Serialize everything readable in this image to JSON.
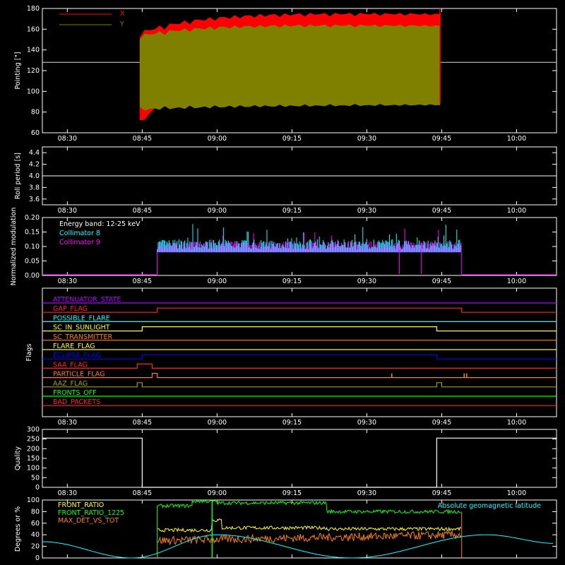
{
  "time_ticks": [
    "08:30",
    "08:45",
    "09:00",
    "09:15",
    "09:30",
    "09:45",
    "10:00"
  ],
  "colors": {
    "x": "#ff0000",
    "y": "#808000",
    "white": "#ffffff",
    "cyan": "#00ffff",
    "magenta": "#ff00ff",
    "yellow": "#ffff00",
    "orange": "#ff8000",
    "green": "#00ff00",
    "blue": "#0000ff",
    "purple": "#b000ff",
    "olive": "#a0a000",
    "red": "#ff2020"
  },
  "chart_data": [
    {
      "type": "area",
      "id": "pointing",
      "ylabel": "Pointing [\"]",
      "ylim": [
        60,
        180
      ],
      "yticks": [
        "60",
        "80",
        "100",
        "120",
        "140",
        "160",
        "180"
      ],
      "legend": [
        "X",
        "Y"
      ],
      "x_range": [
        "08:25",
        "10:08"
      ],
      "reference_value": 128,
      "data_span": [
        "08:44:30",
        "09:44:40"
      ],
      "series": [
        {
          "name": "X",
          "lower_start": 72,
          "lower_end": 136,
          "upper_start": 152,
          "upper_end": 173
        },
        {
          "name": "Y",
          "lower_start": 85,
          "lower_end": 88,
          "upper_start": 150,
          "upper_end": 162
        }
      ]
    },
    {
      "type": "line",
      "id": "roll_period",
      "ylabel": "Roll period [s]",
      "ylim": [
        3.5,
        4.5
      ],
      "yticks": [
        "3.6",
        "3.8",
        "4.0",
        "4.2",
        "4.4"
      ],
      "series": [
        {
          "name": "",
          "value": 4.0
        }
      ]
    },
    {
      "type": "bar",
      "id": "modulation",
      "ylabel": "Normalized modulation",
      "ylim": [
        0,
        0.2
      ],
      "yticks": [
        "0.00",
        "0.05",
        "0.10",
        "0.15",
        "0.20"
      ],
      "annotation": "Energy band: 12-25 keV",
      "legend": [
        "Collimator 8",
        "Collimator 9"
      ],
      "data_span": [
        "08:48",
        "09:49"
      ],
      "baseline": 0.09,
      "peak": 0.19
    },
    {
      "type": "line",
      "id": "flags",
      "ylabel": "Flags",
      "flags": [
        {
          "name": "ATTENUATOR_STATE",
          "color": "#b000ff",
          "steps": []
        },
        {
          "name": "GAP_FLAG",
          "color": "#ff2020",
          "steps": [
            [
              "08:48",
              "09:49"
            ]
          ]
        },
        {
          "name": "POSSIBLE_FLARE",
          "color": "#00ffff",
          "steps": []
        },
        {
          "name": "SC_IN_SUNLIGHT",
          "color": "#ffff00",
          "steps": [
            [
              "08:45",
              "09:44"
            ]
          ]
        },
        {
          "name": "SC_TRANSMITTER",
          "color": "#ff8000",
          "steps": []
        },
        {
          "name": "FLARE_FLAG",
          "color": "#ffff00",
          "steps": []
        },
        {
          "name": "ECLIPSE_FLAG",
          "color": "#0000ff",
          "steps": [
            [
              "08:45",
              "09:44"
            ]
          ]
        },
        {
          "name": "SAA_FLAG",
          "color": "#ff2020",
          "steps": [
            [
              "08:44",
              "08:47"
            ]
          ]
        },
        {
          "name": "PARTICLE_FLAG",
          "color": "#ff8000",
          "steps": [
            [
              "08:47",
              "08:48"
            ]
          ]
        },
        {
          "name": "AAZ_FLAG",
          "color": "#a0a000",
          "steps": [
            [
              "08:44",
              "08:45"
            ],
            [
              "09:44",
              "09:45"
            ]
          ]
        },
        {
          "name": "FRONTS_OFF",
          "color": "#00ff00",
          "steps": []
        },
        {
          "name": "BAD_PACKETS",
          "color": "#ff2020",
          "steps": []
        }
      ]
    },
    {
      "type": "line",
      "id": "quality",
      "ylabel": "Quality",
      "ylim": [
        0,
        300
      ],
      "yticks": [
        "0",
        "50",
        "100",
        "150",
        "200",
        "250",
        "300"
      ],
      "series": [
        {
          "name": "",
          "value_outside": 255,
          "value_inside": 0,
          "span": [
            "08:45",
            "09:44"
          ]
        }
      ]
    },
    {
      "type": "line",
      "id": "ratios",
      "ylabel": "Degrees or %",
      "ylim": [
        0,
        100
      ],
      "yticks": [
        "0",
        "20",
        "40",
        "60",
        "80",
        "100"
      ],
      "legend": [
        "FRONT_RATIO",
        "FRONT_RATIO_1225",
        "MAX_DET_VS_TOT"
      ],
      "annotation": "Absolute geomagnetic latitude",
      "series": [
        {
          "name": "FRONT_RATIO",
          "levels": [
            [
              "08:48",
              "08:59",
              48
            ],
            [
              "08:59",
              "09:01",
              65
            ],
            [
              "09:01",
              "09:22",
              52
            ],
            [
              "09:22",
              "09:49",
              50
            ]
          ]
        },
        {
          "name": "FRONT_RATIO_1225",
          "levels": [
            [
              "08:48",
              "08:55",
              90
            ],
            [
              "08:55",
              "09:00",
              98
            ],
            [
              "09:00",
              "09:22",
              95
            ],
            [
              "09:22",
              "09:49",
              80
            ]
          ]
        },
        {
          "name": "MAX_DET_VS_TOT",
          "levels": [
            [
              "08:48",
              "09:49",
              30
            ]
          ]
        },
        {
          "name": "Absolute geomagnetic latitude",
          "points": [
            [
              "08:25",
              28
            ],
            [
              "08:43",
              0
            ],
            [
              "09:00",
              40
            ],
            [
              "09:27",
              0
            ],
            [
              "09:54",
              40
            ],
            [
              "10:08",
              25
            ]
          ]
        }
      ]
    }
  ]
}
